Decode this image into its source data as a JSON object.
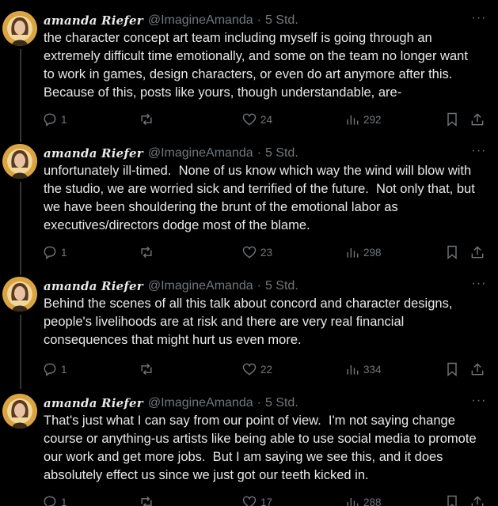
{
  "tweets": [
    {
      "author_name": "amanda Riefer",
      "author_handle": "@ImagineAmanda",
      "separator": "·",
      "timestamp": "5 Std.",
      "more_label": "···",
      "text": "the character concept art team including myself is going through an\nextremely difficult time emotionally, and some on the team no longer want\nto work in games, design characters, or even do art anymore after this.\nBecause of this, posts like yours, though understandable, are-",
      "replies": "1",
      "reposts": "",
      "likes": "24",
      "views": "292"
    },
    {
      "author_name": "amanda Riefer",
      "author_handle": "@ImagineAmanda",
      "separator": "·",
      "timestamp": "5 Std.",
      "more_label": "···",
      "text": "unfortunately ill-timed.  None of us know which way the wind will blow with\nthe studio, we are worried sick and terrified of the future.  Not only that, but\nwe have been shouldering the brunt of the emotional labor as\nexecutives/directors dodge most of the blame.",
      "replies": "1",
      "reposts": "",
      "likes": "23",
      "views": "298"
    },
    {
      "author_name": "amanda Riefer",
      "author_handle": "@ImagineAmanda",
      "separator": "·",
      "timestamp": "5 Std.",
      "more_label": "···",
      "text": "Behind the scenes of all this talk about concord and character designs,\npeople's livelihoods are at risk and there are very real financial\nconsequences that might hurt us even more.",
      "replies": "1",
      "reposts": "",
      "likes": "22",
      "views": "334"
    },
    {
      "author_name": "amanda Riefer",
      "author_handle": "@ImagineAmanda",
      "separator": "·",
      "timestamp": "5 Std.",
      "more_label": "···",
      "text": "That's just what I can say from our point of view.  I'm not saying change\ncourse or anything-us artists like being able to use social media to promote\nour work and get more jobs.  But I am saying we see this, and it does\nabsolutely effect us since we just got our teeth kicked in.",
      "replies": "1",
      "reposts": "",
      "likes": "17",
      "views": "288"
    }
  ],
  "colors": {
    "background": "#000000",
    "text": "#e7e9ea",
    "muted": "#71767b",
    "thread_line": "#333639",
    "avatar_gold": "#d9a441"
  },
  "icons": [
    "reply-icon",
    "repost-icon",
    "like-icon",
    "views-icon",
    "bookmark-icon",
    "share-icon",
    "more-icon"
  ]
}
